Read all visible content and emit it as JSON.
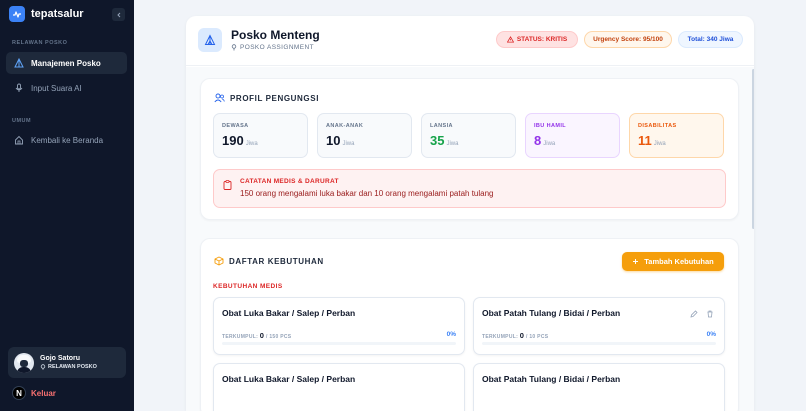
{
  "app": {
    "name": "tepatsalur"
  },
  "sidebar": {
    "section_relawan": "RELAWAN POSKO",
    "section_umum": "UMUM",
    "items": [
      {
        "label": "Manajemen Posko",
        "icon": "tent-icon",
        "active": true
      },
      {
        "label": "Input Suara AI",
        "icon": "microphone-icon",
        "active": false
      },
      {
        "label": "Kembali ke Beranda",
        "icon": "home-icon",
        "active": false
      }
    ],
    "user": {
      "name": "Gojo Satoru",
      "role": "RELAWAN POSKO"
    },
    "logout_label": "Keluar"
  },
  "header": {
    "title": "Posko Menteng",
    "subtitle": "POSKO ASSIGNMENT",
    "status": "STATUS: KRITIS",
    "urgency": "Urgency Score: 95/100",
    "total": "Total: 340 Jiwa"
  },
  "profile": {
    "title": "PROFIL PENGUNGSI",
    "stats": [
      {
        "label": "DEWASA",
        "value": "190",
        "unit": "Jiwa"
      },
      {
        "label": "ANAK-ANAK",
        "value": "10",
        "unit": "Jiwa"
      },
      {
        "label": "LANSIA",
        "value": "35",
        "unit": "Jiwa"
      },
      {
        "label": "IBU HAMIL",
        "value": "8",
        "unit": "Jiwa"
      },
      {
        "label": "DISABILITAS",
        "value": "11",
        "unit": "Jiwa"
      }
    ],
    "medical_note_title": "CATATAN MEDIS & DARURAT",
    "medical_note_text": "150 orang mengalami luka bakar dan 10 orang mengalami patah tulang"
  },
  "needs": {
    "title": "DAFTAR KEBUTUHAN",
    "add_button": "Tambah Kebutuhan",
    "category": "KEBUTUHAN MEDIS",
    "items": [
      {
        "name": "Obat Luka Bakar / Salep / Perban",
        "collected_label": "TERKUMPUL:",
        "collected": "0",
        "target": "/ 150 PCS",
        "percent_text": "0%",
        "progress": 0
      },
      {
        "name": "Obat Patah Tulang / Bidai / Perban",
        "collected_label": "TERKUMPUL:",
        "collected": "0",
        "target": "/ 10 PCS",
        "percent_text": "0%",
        "progress": 0
      },
      {
        "name": "Obat Luka Bakar / Salep / Perban"
      },
      {
        "name": "Obat Patah Tulang / Bidai / Perban"
      }
    ]
  },
  "colors": {
    "sidebar_bg": "#0f172a",
    "accent": "#3b82f6",
    "danger": "#dc2626",
    "warning": "#f59e0b"
  }
}
